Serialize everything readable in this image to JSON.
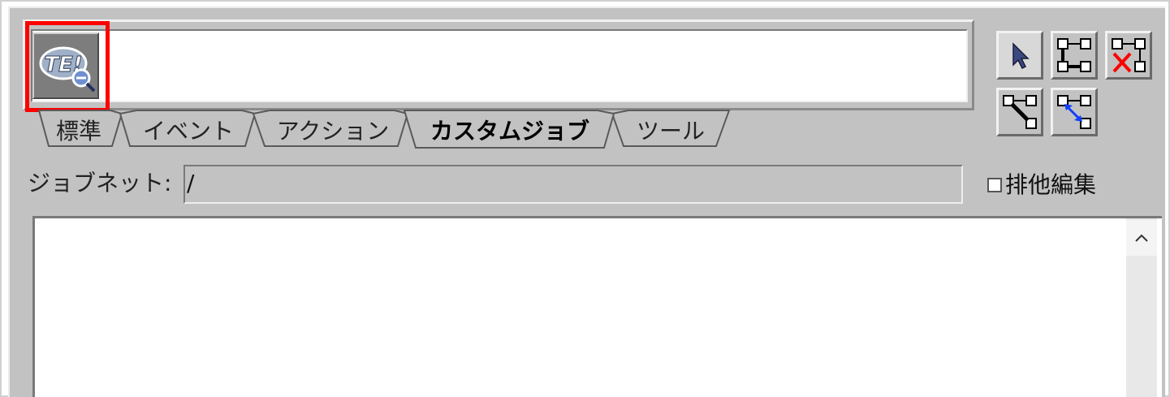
{
  "icon_palette": {
    "selected_icon": "te-custom-job-icon",
    "selected_icon_text": "TE!"
  },
  "tabs": [
    {
      "label": "標準",
      "active": false
    },
    {
      "label": "イベント",
      "active": false
    },
    {
      "label": "アクション",
      "active": false
    },
    {
      "label": "カスタムジョブ",
      "active": true
    },
    {
      "label": "ツール",
      "active": false
    }
  ],
  "jobnet": {
    "label": "ジョブネット:",
    "value": "/"
  },
  "exclusive_edit": {
    "label": "排他編集",
    "checked": false
  },
  "toolbar": {
    "select_mode": "cursor-arrow-icon",
    "connect_mode": "connect-icon",
    "disconnect_mode": "disconnect-icon",
    "connect_condition_mode": "condition-connect-icon",
    "relation_mode": "relation-connect-icon"
  },
  "colors": {
    "highlight": "#ff0000",
    "panel": "#c2c2c2"
  }
}
